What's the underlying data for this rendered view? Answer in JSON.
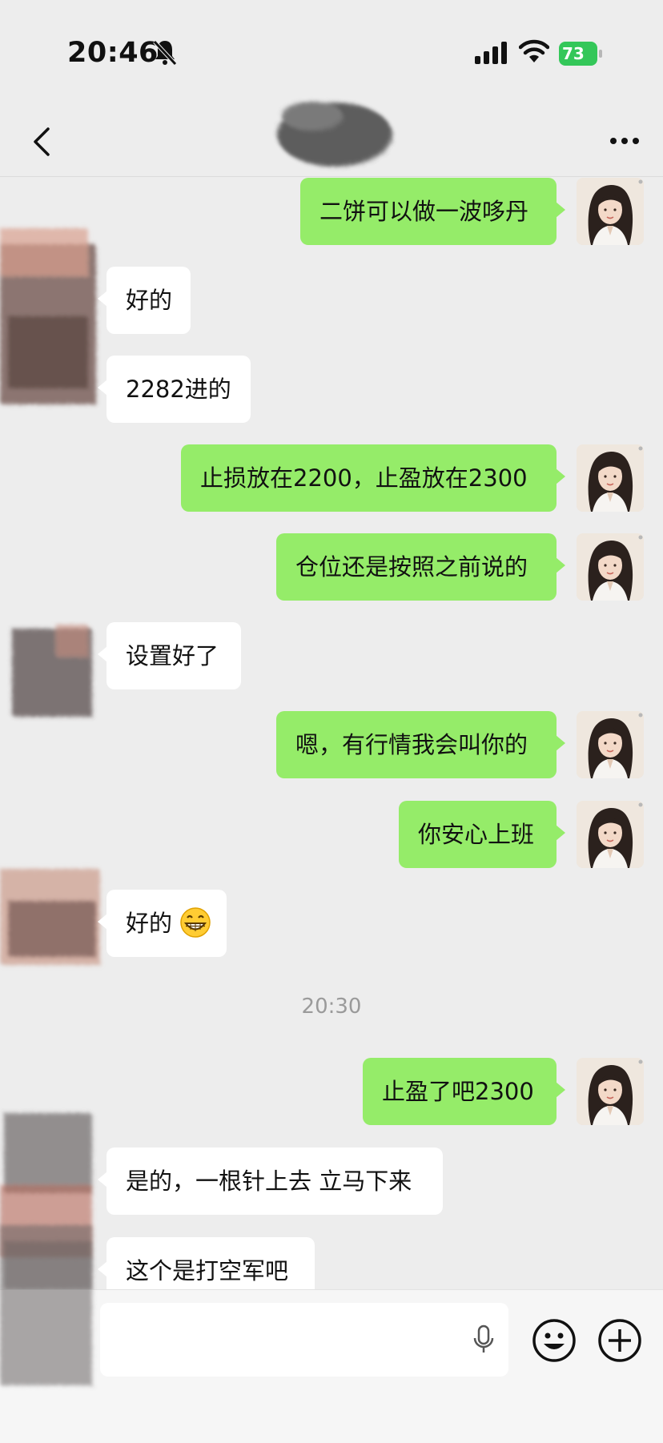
{
  "status_bar": {
    "time": "20:46",
    "battery": "73"
  },
  "nav": {
    "title": ""
  },
  "messages": [
    {
      "side": "out",
      "text": "二饼可以做一波哆丹"
    },
    {
      "side": "in",
      "text": "好的"
    },
    {
      "side": "in",
      "text": "2282进的"
    },
    {
      "side": "out",
      "text": "止损放在2200，止盈放在2300"
    },
    {
      "side": "out",
      "text": "仓位还是按照之前说的"
    },
    {
      "side": "in",
      "text": "设置好了"
    },
    {
      "side": "out",
      "text": "嗯，有行情我会叫你的"
    },
    {
      "side": "out",
      "text": "你安心上班"
    },
    {
      "side": "in",
      "text": "好的",
      "emoji": "grinning-face-emoji"
    },
    {
      "side": "out",
      "text": "止盈了吧2300"
    },
    {
      "side": "in",
      "text": "是的，一根针上去 立马下来"
    },
    {
      "side": "in",
      "text": "这个是打空军吧"
    }
  ],
  "timestamp": "20:30",
  "input": {
    "value": "",
    "placeholder": ""
  },
  "icons": {
    "bell": "bell-slash-icon",
    "signal": "signal-icon",
    "wifi": "wifi-icon",
    "back": "chevron-left-icon",
    "more": "more-icon",
    "mic": "microphone-icon",
    "emoji": "emoji-icon",
    "plus": "plus-icon"
  },
  "colors": {
    "outgoing_bubble": "#95ec69",
    "incoming_bubble": "#ffffff",
    "background": "#ededed",
    "battery": "#34c759"
  }
}
